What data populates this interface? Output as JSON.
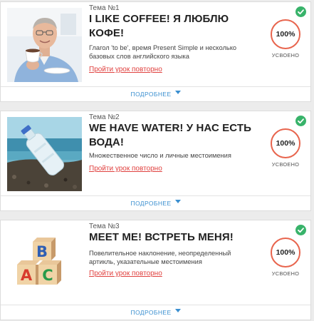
{
  "lessons": [
    {
      "topic": "Тема №1",
      "title": "I LIKE COFFEE! Я ЛЮБЛЮ КОФЕ!",
      "description": "Глагол 'to be', время Present Simple и несколько базовых слов английского языка",
      "retry_label": "Пройти урок повторно",
      "progress": "100%",
      "status": "УСВОЕНО",
      "more_label": "ПОДРОБНЕЕ"
    },
    {
      "topic": "Тема №2",
      "title": "WE HAVE WATER! У НАС ЕСТЬ ВОДА!",
      "description": "Множественное число и личные местоимения",
      "retry_label": "Пройти урок повторно",
      "progress": "100%",
      "status": "УСВОЕНО",
      "more_label": "ПОДРОБНЕЕ"
    },
    {
      "topic": "Тема №3",
      "title": "MEET ME! ВСТРЕТЬ МЕНЯ!",
      "description": "Повелительное наклонение, неопределенный артикль, указательные местоимения",
      "retry_label": "Пройти урок повторно",
      "progress": "100%",
      "status": "УСВОЕНО",
      "more_label": "ПОДРОБНЕЕ",
      "blocks": [
        "B",
        "A",
        "C"
      ]
    }
  ],
  "colors": {
    "accent_red": "#e0413f",
    "ring": "#e8654e",
    "check_green": "#38b36a",
    "link_blue": "#3a8fd0"
  }
}
